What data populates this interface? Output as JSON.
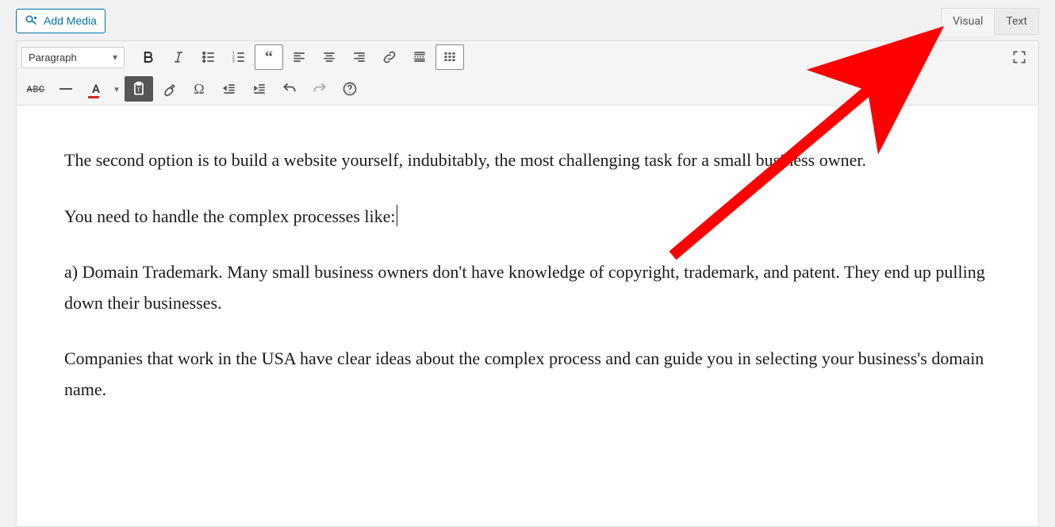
{
  "media_button": {
    "label": "Add Media"
  },
  "tabs": {
    "visual": "Visual",
    "text": "Text",
    "active": "visual"
  },
  "format_select": {
    "value": "Paragraph"
  },
  "toolbar_row1": {
    "bold": "bold-icon",
    "italic": "italic-icon",
    "ul": "bulleted-list-icon",
    "ol": "numbered-list-icon",
    "blockquote": "blockquote-icon",
    "align_left": "align-left-icon",
    "align_center": "align-center-icon",
    "align_right": "align-right-icon",
    "link": "link-icon",
    "readmore": "read-more-icon",
    "toolbar_toggle": "toolbar-toggle-icon",
    "fullscreen": "fullscreen-icon"
  },
  "toolbar_row2": {
    "strike": "ABC",
    "hr": "horizontal-rule-icon",
    "textcolor": "A",
    "textcolor_hex": "#d9261c",
    "paste": "paste-plain-icon",
    "clear": "clear-formatting-icon",
    "omega": "Ω",
    "outdent": "outdent-icon",
    "indent": "indent-icon",
    "undo": "undo-icon",
    "redo": "redo-icon",
    "help": "help-icon"
  },
  "content": {
    "p1": "The second option is to build a website yourself, indubitably, the most challenging task for a small business owner.",
    "p2": "You need to handle the complex processes like:",
    "p3": "a) Domain Trademark. Many small business owners don't have knowledge of copyright, trademark, and patent. They end up pulling down their businesses.",
    "p4": "Companies that work in the USA have clear ideas about the complex process and can guide you in selecting your business's domain name."
  },
  "annotation": {
    "arrow_color": "#ff0000"
  }
}
